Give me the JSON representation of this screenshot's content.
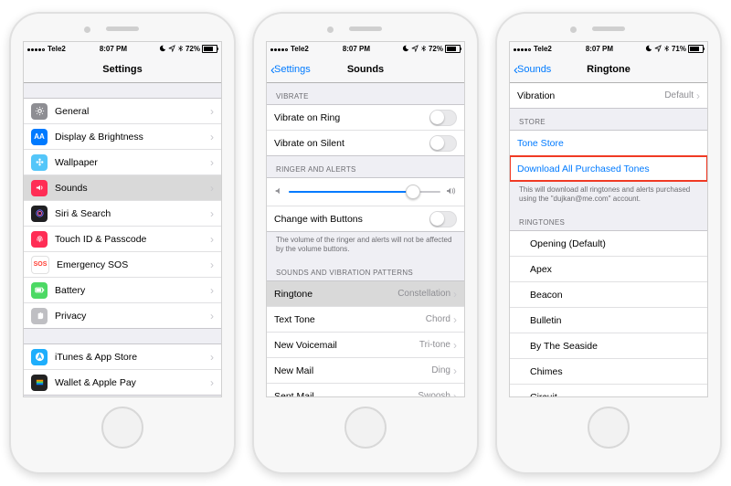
{
  "phone1": {
    "status": {
      "carrier": "Tele2",
      "wifi": "wifi-icon",
      "time": "8:07 PM",
      "dnd": "moon-icon",
      "loc": "location-icon",
      "bt": "bluetooth-icon",
      "battery_pct": "72%",
      "battery_fill": 0.72
    },
    "nav": {
      "title": "Settings"
    },
    "groups": {
      "g1": [
        {
          "key": "general",
          "label": "General",
          "bg": "#8e8e93",
          "glyph": "gear"
        },
        {
          "key": "display",
          "label": "Display & Brightness",
          "bg": "#007aff",
          "glyph": "AA"
        },
        {
          "key": "wallpaper",
          "label": "Wallpaper",
          "bg": "#54c6f9",
          "glyph": "flower"
        },
        {
          "key": "sounds",
          "label": "Sounds",
          "bg": "#ff2d55",
          "glyph": "speaker",
          "selected": true
        },
        {
          "key": "siri",
          "label": "Siri & Search",
          "bg": "#1f1f22",
          "glyph": "siri"
        },
        {
          "key": "touchid",
          "label": "Touch ID & Passcode",
          "bg": "#ff2d55",
          "glyph": "fingerprint"
        },
        {
          "key": "sos",
          "label": "Emergency SOS",
          "bg": "#ffffff",
          "fg": "#ff3b30",
          "glyph": "SOS"
        },
        {
          "key": "battery",
          "label": "Battery",
          "bg": "#4cd964",
          "glyph": "battery"
        },
        {
          "key": "privacy",
          "label": "Privacy",
          "bg": "#bfbfc3",
          "glyph": "hand"
        }
      ],
      "g2": [
        {
          "key": "itunes",
          "label": "iTunes & App Store",
          "bg": "#1eaefc",
          "glyph": "appstore"
        },
        {
          "key": "wallet",
          "label": "Wallet & Apple Pay",
          "bg": "#222",
          "glyph": "wallet"
        }
      ]
    }
  },
  "phone2": {
    "status": {
      "carrier": "Tele2",
      "time": "8:07 PM",
      "battery_pct": "72%",
      "battery_fill": 0.72
    },
    "nav": {
      "back": "Settings",
      "title": "Sounds"
    },
    "sections": {
      "vibrate_header": "Vibrate",
      "vibrate": [
        {
          "key": "vibrate-ring",
          "label": "Vibrate on Ring"
        },
        {
          "key": "vibrate-silent",
          "label": "Vibrate on Silent"
        }
      ],
      "ringer_header": "Ringer and Alerts",
      "slider_value": 0.82,
      "change_buttons_label": "Change with Buttons",
      "ringer_footer": "The volume of the ringer and alerts will not be affected by the volume buttons.",
      "patterns_header": "Sounds and Vibration Patterns",
      "patterns": [
        {
          "key": "ringtone",
          "label": "Ringtone",
          "detail": "Constellation",
          "selected": true
        },
        {
          "key": "texttone",
          "label": "Text Tone",
          "detail": "Chord"
        },
        {
          "key": "voicemail",
          "label": "New Voicemail",
          "detail": "Tri-tone"
        },
        {
          "key": "newmail",
          "label": "New Mail",
          "detail": "Ding"
        },
        {
          "key": "sentmail",
          "label": "Sent Mail",
          "detail": "Swoosh"
        }
      ]
    }
  },
  "phone3": {
    "status": {
      "carrier": "Tele2",
      "time": "8:07 PM",
      "battery_pct": "71%",
      "battery_fill": 0.71
    },
    "nav": {
      "back": "Sounds",
      "title": "Ringtone"
    },
    "vibration": {
      "label": "Vibration",
      "detail": "Default"
    },
    "store_header": "Store",
    "store": [
      {
        "key": "tone-store",
        "label": "Tone Store"
      },
      {
        "key": "download-all",
        "label": "Download All Purchased Tones",
        "highlight": true
      }
    ],
    "store_footer": "This will download all ringtones and alerts purchased using the \"dujkan@me.com\" account.",
    "ringtones_header": "Ringtones",
    "ringtones": [
      {
        "key": "opening",
        "label": "Opening (Default)"
      },
      {
        "key": "apex",
        "label": "Apex"
      },
      {
        "key": "beacon",
        "label": "Beacon"
      },
      {
        "key": "bulletin",
        "label": "Bulletin"
      },
      {
        "key": "seaside",
        "label": "By The Seaside"
      },
      {
        "key": "chimes",
        "label": "Chimes"
      },
      {
        "key": "circuit",
        "label": "Circuit"
      }
    ]
  }
}
